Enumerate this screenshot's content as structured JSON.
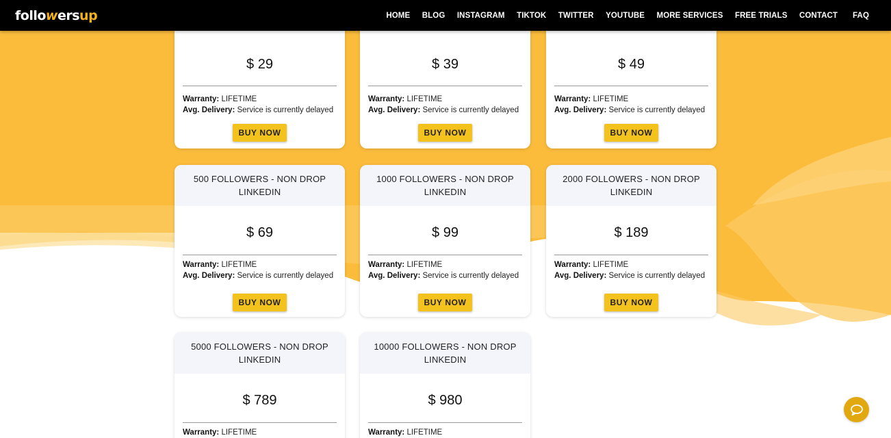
{
  "nav": {
    "logo": {
      "part1": "follo",
      "part2": "w",
      "part3": "ers",
      "part4": "up"
    },
    "links": [
      "HOME",
      "BLOG",
      "INSTAGRAM",
      "TIKTOK",
      "TWITTER",
      "YOUTUBE",
      "MORE SERVICES",
      "FREE TRIALS",
      "CONTACT",
      "FAQ"
    ]
  },
  "labels": {
    "warranty": "Warranty:",
    "delivery": "Avg. Delivery:",
    "buy": "BUY NOW"
  },
  "cards": [
    {
      "title": "",
      "price": "$ 29",
      "warranty": "LIFETIME",
      "delivery": "Service is currently delayed"
    },
    {
      "title": "",
      "price": "$ 39",
      "warranty": "LIFETIME",
      "delivery": "Service is currently delayed"
    },
    {
      "title": "",
      "price": "$ 49",
      "warranty": "LIFETIME",
      "delivery": "Service is currently delayed"
    },
    {
      "title": "500 FOLLOWERS - NON DROP LINKEDIN",
      "price": "$ 69",
      "warranty": "LIFETIME",
      "delivery": "Service is currently delayed"
    },
    {
      "title": "1000 FOLLOWERS - NON DROP LINKEDIN",
      "price": "$ 99",
      "warranty": "LIFETIME",
      "delivery": "Service is currently delayed"
    },
    {
      "title": "2000 FOLLOWERS - NON DROP LINKEDIN",
      "price": "$ 189",
      "warranty": "LIFETIME",
      "delivery": "Service is currently delayed"
    },
    {
      "title": "5000 FOLLOWERS - NON DROP LINKEDIN",
      "price": "$ 789",
      "warranty": "LIFETIME",
      "delivery": ""
    },
    {
      "title": "10000 FOLLOWERS - NON DROP LINKEDIN",
      "price": "$ 980",
      "warranty": "LIFETIME",
      "delivery": ""
    }
  ],
  "colors": {
    "accent": "#f3c21c",
    "background_wave": "#fbbc3c",
    "navbar": "#000000",
    "chat": "#e2a80f"
  },
  "icons": {
    "chat": "chat-bubble-icon"
  }
}
